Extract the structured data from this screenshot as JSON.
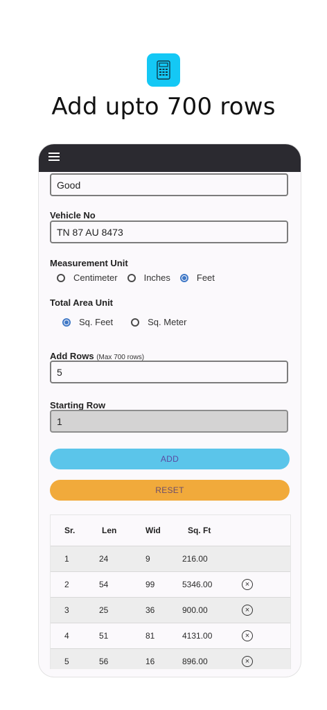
{
  "promo": {
    "headline": "Add upto 700 rows",
    "icon": "calculator-icon",
    "icon_color": "#14c8f5"
  },
  "form": {
    "condition_value": "Good",
    "vehicle_no_label": "Vehicle No",
    "vehicle_no_value": "TN 87 AU 8473",
    "measurement_unit_label": "Measurement Unit",
    "measurement_options": [
      "Centimeter",
      "Inches",
      "Feet"
    ],
    "measurement_selected": "Feet",
    "area_unit_label": "Total Area Unit",
    "area_options": [
      "Sq. Feet",
      "Sq. Meter"
    ],
    "area_selected": "Sq. Feet",
    "add_rows_label": "Add Rows",
    "add_rows_hint": "(Max 700 rows)",
    "add_rows_value": "5",
    "starting_row_label": "Starting Row",
    "starting_row_value": "1",
    "add_button": "ADD",
    "reset_button": "RESET"
  },
  "table": {
    "headers": [
      "Sr.",
      "Len",
      "Wid",
      "Sq. Ft"
    ],
    "rows": [
      [
        "1",
        "24",
        "9",
        "216.00"
      ],
      [
        "2",
        "54",
        "99",
        "5346.00"
      ],
      [
        "3",
        "25",
        "36",
        "900.00"
      ],
      [
        "4",
        "51",
        "81",
        "4131.00"
      ],
      [
        "5",
        "56",
        "16",
        "896.00"
      ]
    ]
  },
  "colors": {
    "appbar": "#2b2a30",
    "add": "#5bc5ea",
    "reset": "#f1aa3b",
    "radio_on": "#3f78c6"
  }
}
